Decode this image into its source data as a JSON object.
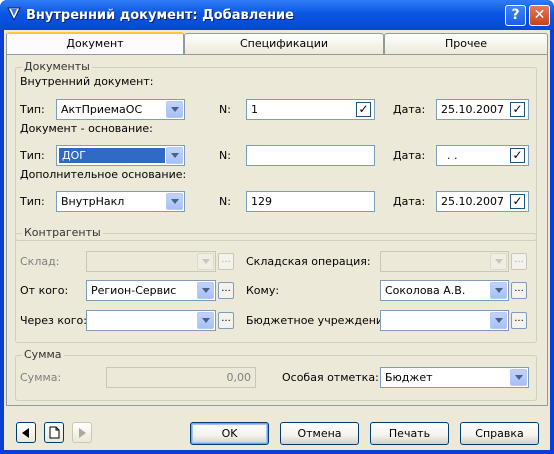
{
  "window": {
    "title": "Внутренний документ: Добавление",
    "help_label": "?",
    "close_label": "✕"
  },
  "tabs": [
    {
      "label": "Документ",
      "active": true
    },
    {
      "label": "Спецификации",
      "active": false
    },
    {
      "label": "Прочее",
      "active": false
    }
  ],
  "documents": {
    "group_label": "Документы",
    "internal_label": "Внутренний документ:",
    "basis_label": "Документ - основание:",
    "additional_label": "Дополнительное основание:",
    "type_label": "Тип:",
    "n_label": "N:",
    "date_label": "Дата:",
    "rows": [
      {
        "type": "АктПриемаОС",
        "n": "1",
        "date": "25.10.2007"
      },
      {
        "type": "ДОГ",
        "n": "",
        "date": ". ."
      },
      {
        "type": "ВнутрНакл",
        "n": "129",
        "date": "25.10.2007"
      }
    ]
  },
  "contractors": {
    "group_label": "Контрагенты",
    "warehouse_label": "Склад:",
    "warehouse_value": "",
    "operation_label": "Складская операция:",
    "operation_value": "",
    "from_label": "От кого:",
    "from_value": "Регион-Сервис",
    "to_label": "Кому:",
    "to_value": "Соколова А.В.",
    "via_label": "Через кого:",
    "via_value": "",
    "budget_label": "Бюджетное учреждение:",
    "budget_value": "",
    "ellipsis": "..."
  },
  "sum": {
    "group_label": "Сумма",
    "sum_label": "Сумма:",
    "sum_value": "0,00",
    "mark_label": "Особая отметка:",
    "mark_value": "Бюджет"
  },
  "footer": {
    "ok": "OK",
    "cancel": "Отмена",
    "print": "Печать",
    "help": "Справка"
  },
  "colors": {
    "title_bar": "#0b56e5",
    "dialog_bg": "#ece9d8",
    "selection": "#316ac5",
    "check": "#21a121"
  }
}
